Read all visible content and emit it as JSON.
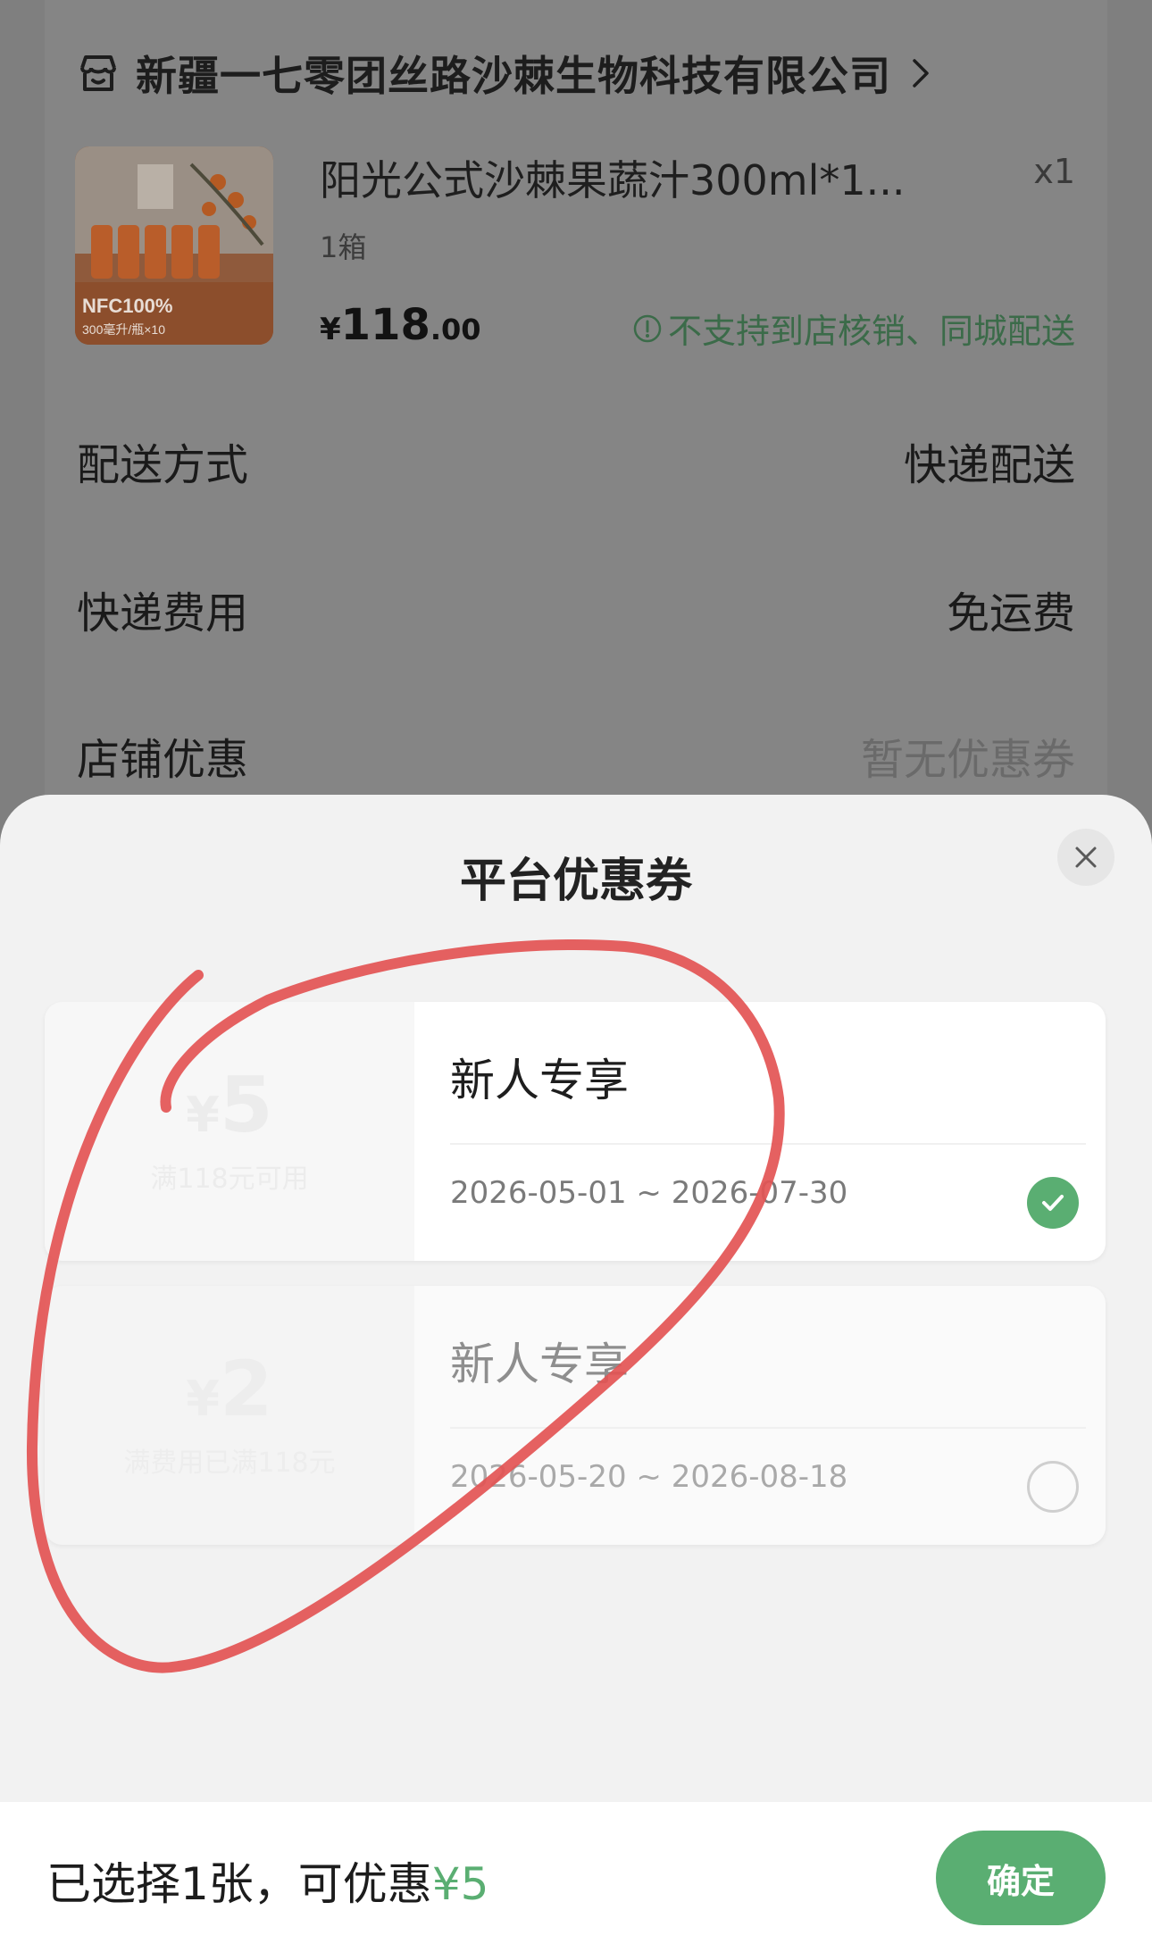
{
  "store": {
    "name": "新疆一七零团丝路沙棘生物科技有限公司",
    "icon": "store-icon"
  },
  "product": {
    "name": "阳光公式沙棘果蔬汁300ml*1...",
    "quantity": "x1",
    "spec": "1箱",
    "price_yen": "¥",
    "price_int": "118",
    "price_cents": ".00",
    "warning": "不支持到店核销、同城配送",
    "image_badge": "NFC100%",
    "image_sub": "300毫升/瓶×10"
  },
  "rows": [
    {
      "label": "配送方式",
      "value": "快递配送"
    },
    {
      "label": "快递费用",
      "value": "免运费"
    },
    {
      "label": "店铺优惠",
      "value": "暂无优惠券"
    }
  ],
  "sheet": {
    "title": "平台优惠券",
    "coupons": [
      {
        "amount": "5",
        "yen": "¥",
        "condition": "满118元可用",
        "name": "新人专享",
        "dates": "2026-05-01 ~ 2026-07-30",
        "selected": true
      },
      {
        "amount": "2",
        "yen": "¥",
        "condition": "满费用已满118元",
        "name": "新人专享",
        "dates": "2026-05-20 ~ 2026-08-18",
        "selected": false
      }
    ]
  },
  "footer": {
    "selected_text": "已选择1张，可优惠",
    "discount": "¥5",
    "confirm_label": "确定"
  },
  "colors": {
    "accent_green": "#5aae72",
    "annotation_red": "#e35454",
    "overlay_gray": "#7f7f7f"
  }
}
